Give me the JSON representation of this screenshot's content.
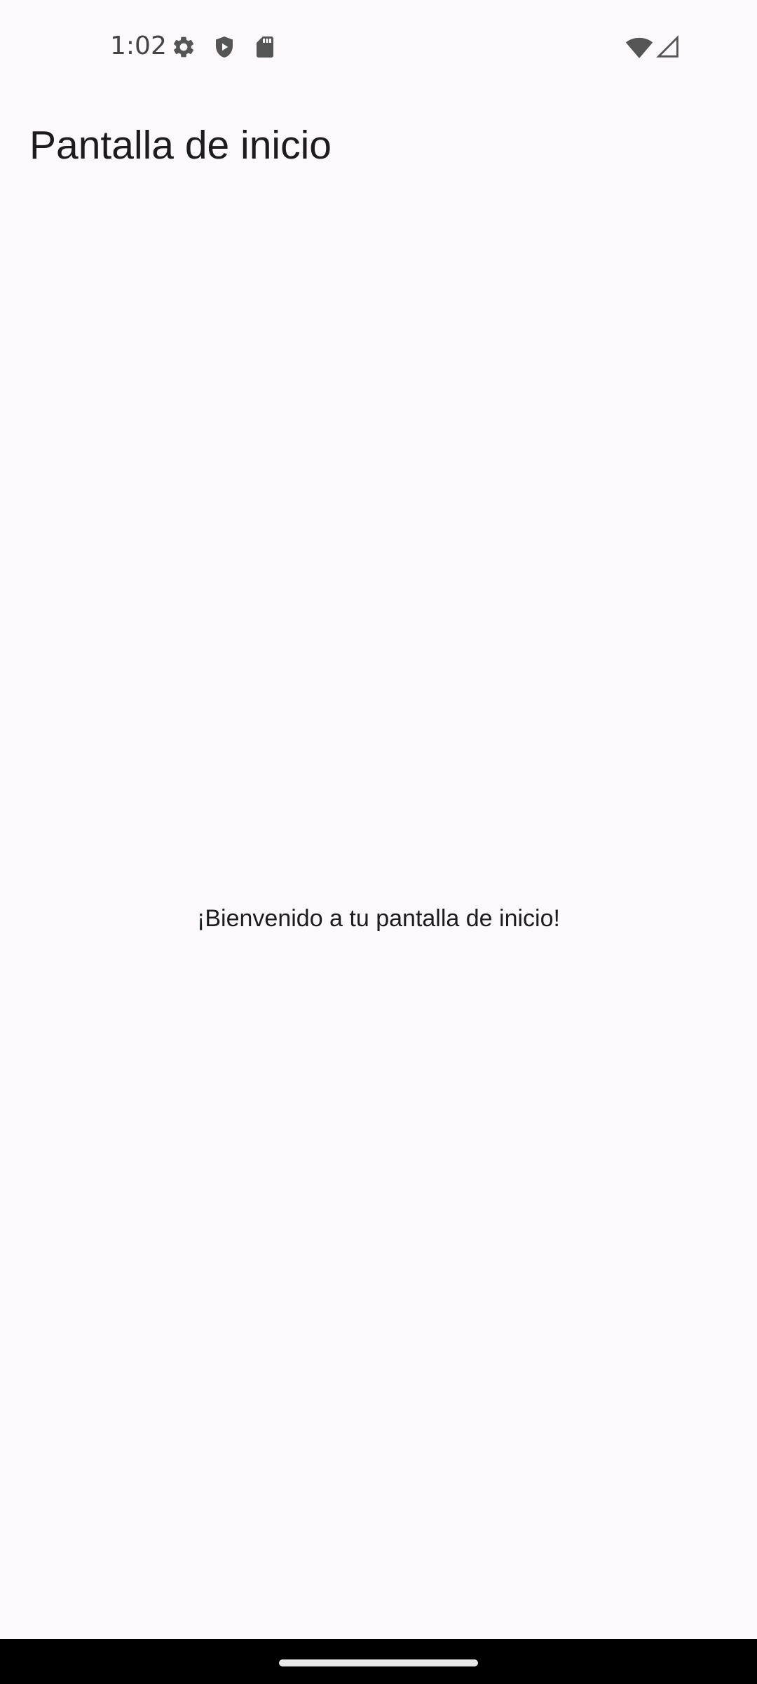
{
  "status_bar": {
    "time": "1:02",
    "icons_left": [
      "settings-icon",
      "shield-icon",
      "sd-card-icon"
    ],
    "icons_right": [
      "wifi-icon",
      "cellular-signal-icon"
    ]
  },
  "app_bar": {
    "title": "Pantalla de inicio"
  },
  "body": {
    "welcome_text": "¡Bienvenido a tu pantalla de inicio!"
  },
  "colors": {
    "background": "#fdf8fc",
    "text": "#1c1b1f",
    "status_icons": "#555555",
    "nav_bar": "#000000"
  }
}
